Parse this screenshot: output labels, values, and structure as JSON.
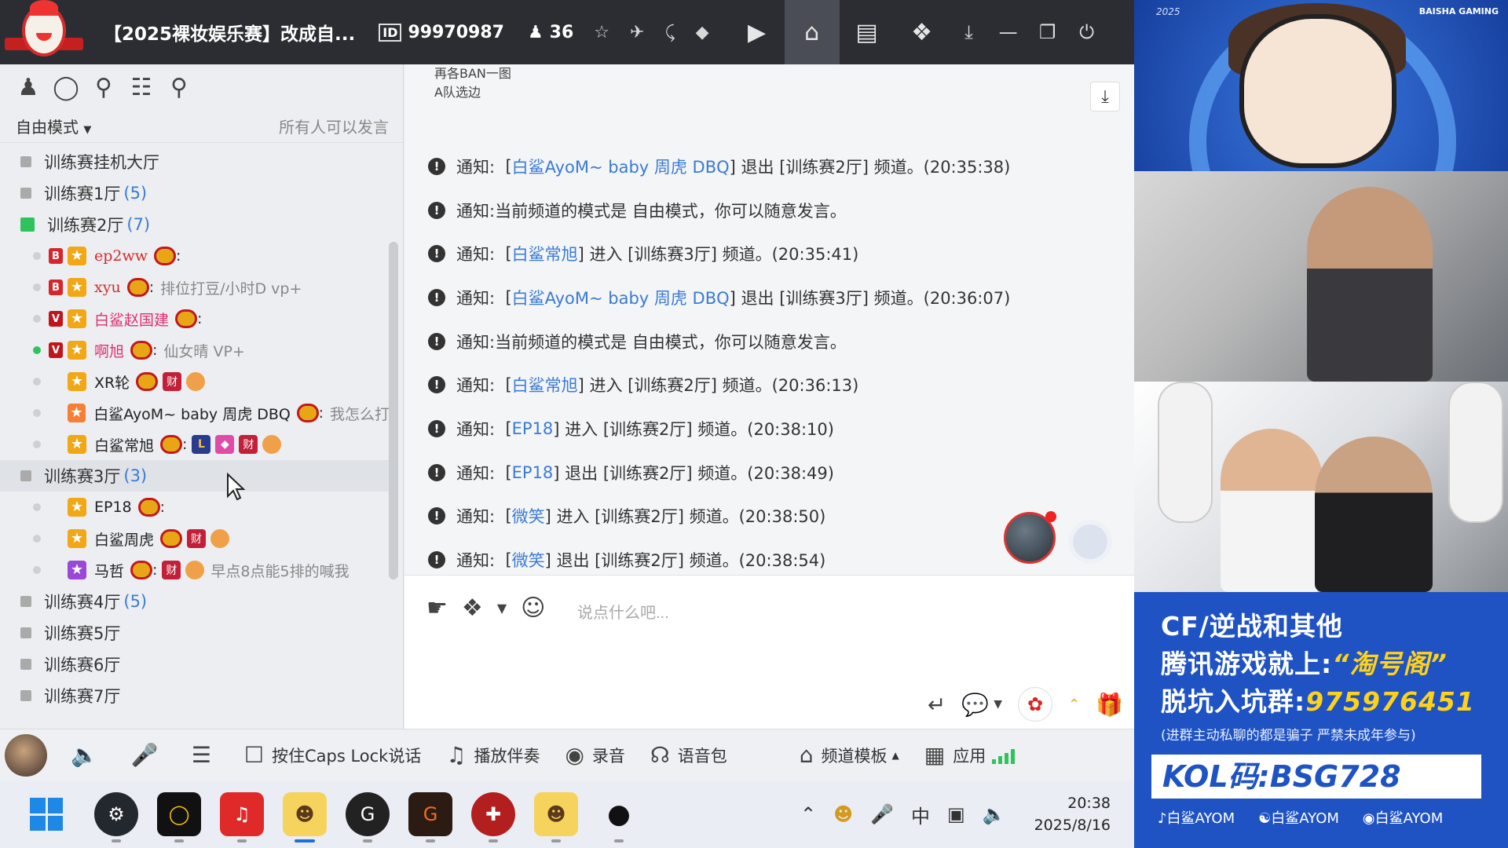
{
  "titlebar": {
    "room_title": "【2025裸妆娱乐赛】改成自...",
    "room_id_label": "ID",
    "room_id": "99970987",
    "online_count": "36",
    "icons": [
      "star-icon",
      "plane-icon",
      "share-icon",
      "shield-icon",
      "video-icon",
      "home-icon",
      "list-icon",
      "gamepad-icon",
      "download-icon",
      "minimize-icon",
      "restore-icon",
      "power-icon"
    ]
  },
  "left": {
    "mode": "自由模式",
    "mode_hint": "所有人可以发言",
    "channels": [
      {
        "name": "训练赛挂机大厅",
        "count": ""
      },
      {
        "name": "训练赛1厅",
        "count": "(5)"
      },
      {
        "name": "训练赛2厅",
        "count": "(7)"
      },
      {
        "name": "训练赛3厅",
        "count": "(3)"
      },
      {
        "name": "训练赛4厅",
        "count": "(5)"
      },
      {
        "name": "训练赛5厅",
        "count": ""
      },
      {
        "name": "训练赛6厅",
        "count": ""
      },
      {
        "name": "训练赛7厅",
        "count": ""
      }
    ],
    "hall2_members": [
      {
        "name": "ep2ww",
        "sig": ""
      },
      {
        "name": "xyu",
        "sig": "排位打豆/小时D vp+"
      },
      {
        "name": "白鲨赵国建",
        "sig": ""
      },
      {
        "name": "啊旭",
        "sig": "仙女晴 VP+"
      },
      {
        "name": "XR轮",
        "sig": ""
      },
      {
        "name": "白鲨AyoM~ baby 周虎 DBQ",
        "sig": "我怎么打"
      },
      {
        "name": "白鲨常旭",
        "sig": ""
      }
    ],
    "hall3_members": [
      {
        "name": "EP18",
        "sig": ""
      },
      {
        "name": "白鲨周虎",
        "sig": ""
      },
      {
        "name": "马哲",
        "sig": "早点8点能5排的喊我"
      }
    ],
    "badge_b": "B",
    "badge_v": "V",
    "tag_cai": "财",
    "tag_l": "L"
  },
  "chat": {
    "top_line1": "再各BAN一图",
    "top_line2": "A队选边",
    "notice_label": "通知:",
    "messages": [
      {
        "pre": "[",
        "who": "白鲨AyoM~ baby 周虎 DBQ",
        "post": "] 退出 [训练赛2厅] 频道。(20:35:38)"
      },
      {
        "pre": "",
        "who": "",
        "post": "当前频道的模式是 自由模式，你可以随意发言。"
      },
      {
        "pre": "[",
        "who": "白鲨常旭",
        "post": "] 进入 [训练赛3厅] 频道。(20:35:41)"
      },
      {
        "pre": "[",
        "who": "白鲨AyoM~ baby 周虎 DBQ",
        "post": "] 退出 [训练赛3厅] 频道。(20:36:07)"
      },
      {
        "pre": "",
        "who": "",
        "post": "当前频道的模式是 自由模式，你可以随意发言。"
      },
      {
        "pre": "[",
        "who": "白鲨常旭",
        "post": "] 进入 [训练赛2厅] 频道。(20:36:13)"
      },
      {
        "pre": "[",
        "who": "EP18",
        "post": "] 进入 [训练赛2厅] 频道。(20:38:10)"
      },
      {
        "pre": "[",
        "who": "EP18",
        "post": "] 退出 [训练赛2厅] 频道。(20:38:49)"
      },
      {
        "pre": "[",
        "who": "微笑",
        "post": "] 进入 [训练赛2厅] 频道。(20:38:50)"
      },
      {
        "pre": "[",
        "who": "微笑",
        "post": "] 退出 [训练赛2厅] 频道。(20:38:54)"
      }
    ],
    "input_placeholder": "说点什么吧..."
  },
  "toolbar": {
    "caps_label": "按住Caps Lock说话",
    "accompany": "播放伴奏",
    "record": "录音",
    "voice_pack": "语音包",
    "channel_template": "频道模板",
    "apps": "应用"
  },
  "taskbar": {
    "ime": "中",
    "time": "20:38",
    "date": "2025/8/16"
  },
  "stream": {
    "year": "2025",
    "team": "BAISHA GAMING",
    "ad_line1": "CF/逆战和其他",
    "ad_line2a": "腾讯游戏就上:",
    "ad_line2b": "“淘号阁”",
    "ad_line3a": "脱坑入坑群:",
    "ad_line3b": "975976451",
    "ad_note": "(进群主动私聊的都是骗子 严禁未成年参与)",
    "kol": "KOL码:BSG728",
    "socials": [
      "白鲨AYOM",
      "白鲨AYOM",
      "白鲨AYOM"
    ]
  }
}
